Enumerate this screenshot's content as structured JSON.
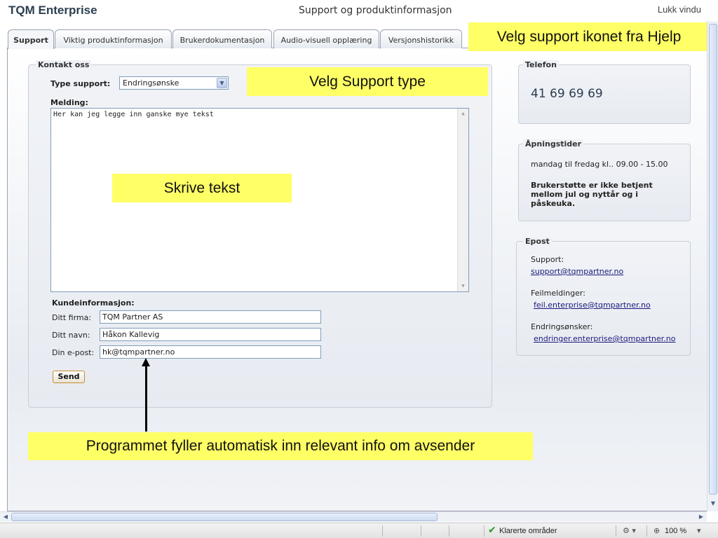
{
  "window": {
    "app_title": "TQM Enterprise",
    "title": "Support og produktinformasjon",
    "close_label": "Lukk vindu"
  },
  "tabs": [
    {
      "label": "Support",
      "active": true
    },
    {
      "label": "Viktig produktinformasjon",
      "active": false
    },
    {
      "label": "Brukerdokumentasjon",
      "active": false
    },
    {
      "label": "Audio-visuell opplæring",
      "active": false
    },
    {
      "label": "Versjonshistorikk",
      "active": false
    }
  ],
  "contact": {
    "legend": "Kontakt oss",
    "support_type_label": "Type support:",
    "support_type_value": "Endringsønske",
    "message_label": "Melding:",
    "message_text": "Her kan jeg legge inn ganske mye tekst",
    "customer_info_label": "Kundeinformasjon:",
    "company_label": "Ditt firma:",
    "company_value": "TQM Partner AS",
    "name_label": "Ditt navn:",
    "name_value": "Håkon Kallevig",
    "email_label": "Din e-post:",
    "email_value": "hk@tqmpartner.no",
    "send_label": "Send"
  },
  "phone": {
    "legend": "Telefon",
    "number": "41 69 69 69"
  },
  "hours": {
    "legend": "Åpningstider",
    "text": "mandag til fredag kl.. 09.00 - 15.00",
    "note": "Brukerstøtte er ikke betjent mellom jul og nyttår og i påskeuka."
  },
  "email": {
    "legend": "Epost",
    "support_label": "Support:",
    "support_address": "support@tqmpartner.no",
    "error_label": "Feilmeldinger:",
    "error_address": "feil.enterprise@tqmpartner.no",
    "change_label": "Endringsønsker:",
    "change_address": "endringer.enterprise@tqmpartner.no"
  },
  "callouts": {
    "help_icon": "Velg support ikonet fra Hjelp",
    "support_type": "Velg Support type",
    "write_text": "Skrive tekst",
    "auto_fill": "Programmet fyller automatisk inn relevant info om avsender"
  },
  "statusbar": {
    "zone": "Klarerte områder",
    "zoom": "100 %"
  },
  "colors": {
    "callout": "#ffff66",
    "title": "#2c3e50",
    "link": "#1a1a7a"
  }
}
